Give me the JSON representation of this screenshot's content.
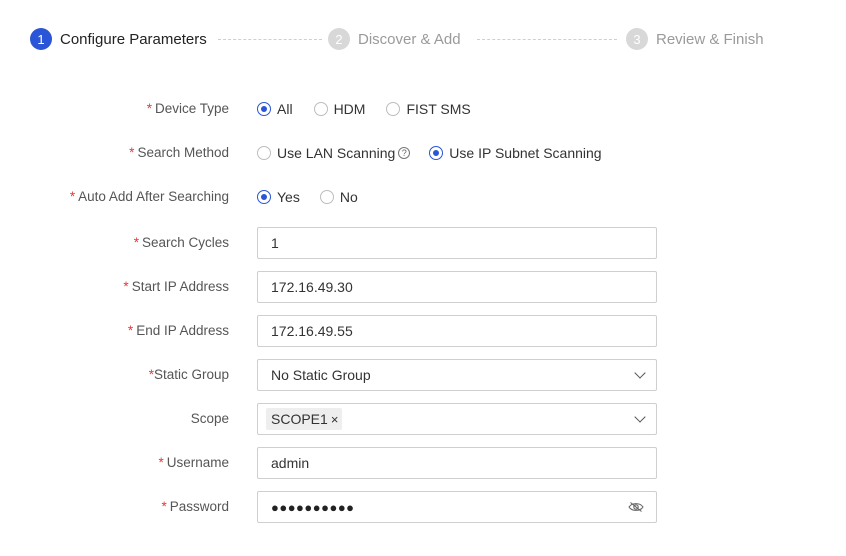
{
  "steps": [
    {
      "number": "1",
      "label": "Configure Parameters",
      "state": "active"
    },
    {
      "number": "2",
      "label": "Discover & Add",
      "state": "inactive"
    },
    {
      "number": "3",
      "label": "Review & Finish",
      "state": "inactive"
    }
  ],
  "form": {
    "required_mark": "*",
    "device_type": {
      "label": "Device Type",
      "options": [
        "All",
        "HDM",
        "FIST SMS"
      ],
      "selected": "All"
    },
    "search_method": {
      "label": "Search Method",
      "options": [
        "Use LAN Scanning",
        "Use IP Subnet Scanning"
      ],
      "help_glyph": "?",
      "selected": "Use IP Subnet Scanning"
    },
    "auto_add": {
      "label": "Auto Add After Searching",
      "options": [
        "Yes",
        "No"
      ],
      "selected": "Yes"
    },
    "search_cycles": {
      "label": "Search Cycles",
      "value": "1"
    },
    "start_ip": {
      "label": "Start IP Address",
      "value": "172.16.49.30"
    },
    "end_ip": {
      "label": "End IP Address",
      "value": "172.16.49.55"
    },
    "static_group": {
      "label": "Static Group",
      "value": "No Static Group"
    },
    "scope": {
      "label": "Scope",
      "tag": "SCOPE1",
      "tag_close": "×"
    },
    "username": {
      "label": "Username",
      "value": "admin"
    },
    "password": {
      "label": "Password",
      "masked": "●●●●●●●●●●"
    }
  },
  "colors": {
    "accent": "#2a55d6",
    "required": "#e03a3a",
    "inactive_step": "#d8d8d8"
  },
  "icons": {
    "help": "question-circle-icon",
    "dropdown": "chevron-down-icon",
    "password_toggle": "eye-slash-icon",
    "tag_close": "close-icon"
  }
}
